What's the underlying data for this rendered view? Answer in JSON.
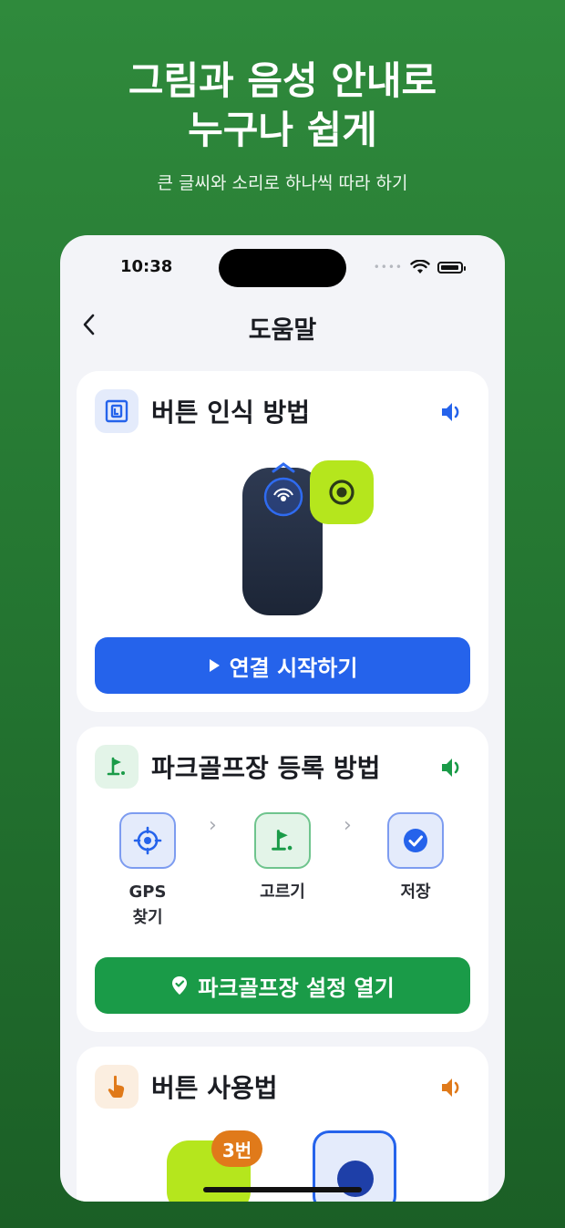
{
  "promo": {
    "title_line1": "그림과 음성 안내로",
    "title_line2": "누구나 쉽게",
    "subtitle": "큰 글씨와 소리로 하나씩 따라 하기"
  },
  "status_bar": {
    "time": "10:38",
    "signal_dots": "••••"
  },
  "nav": {
    "title": "도움말",
    "back_icon": "chevron-left-icon"
  },
  "cards": {
    "recognition": {
      "title": "버튼 인식 방법",
      "icon": "nfc-icon",
      "button_label": "연결 시작하기",
      "button_icon": "play-icon",
      "accent": "#2563eb"
    },
    "park_golf": {
      "title": "파크골프장 등록 방법",
      "icon": "flag-icon",
      "steps": [
        {
          "label": "GPS\n찾기",
          "label_line1": "GPS",
          "label_line2": "찾기",
          "icon": "crosshair-icon"
        },
        {
          "label": "고르기",
          "icon": "flag-icon"
        },
        {
          "label": "저장",
          "icon": "check-circle-icon"
        }
      ],
      "button_label": "파크골프장 설정 열기",
      "button_icon": "location-check-icon",
      "accent": "#1a9b48"
    },
    "usage": {
      "title": "버튼 사용법",
      "icon": "tap-hand-icon",
      "badge": "3번",
      "accent": "#e07a1a"
    }
  },
  "colors": {
    "background_green": "#2a7e36",
    "lime": "#b5e61d",
    "dark_device": "#243044"
  }
}
